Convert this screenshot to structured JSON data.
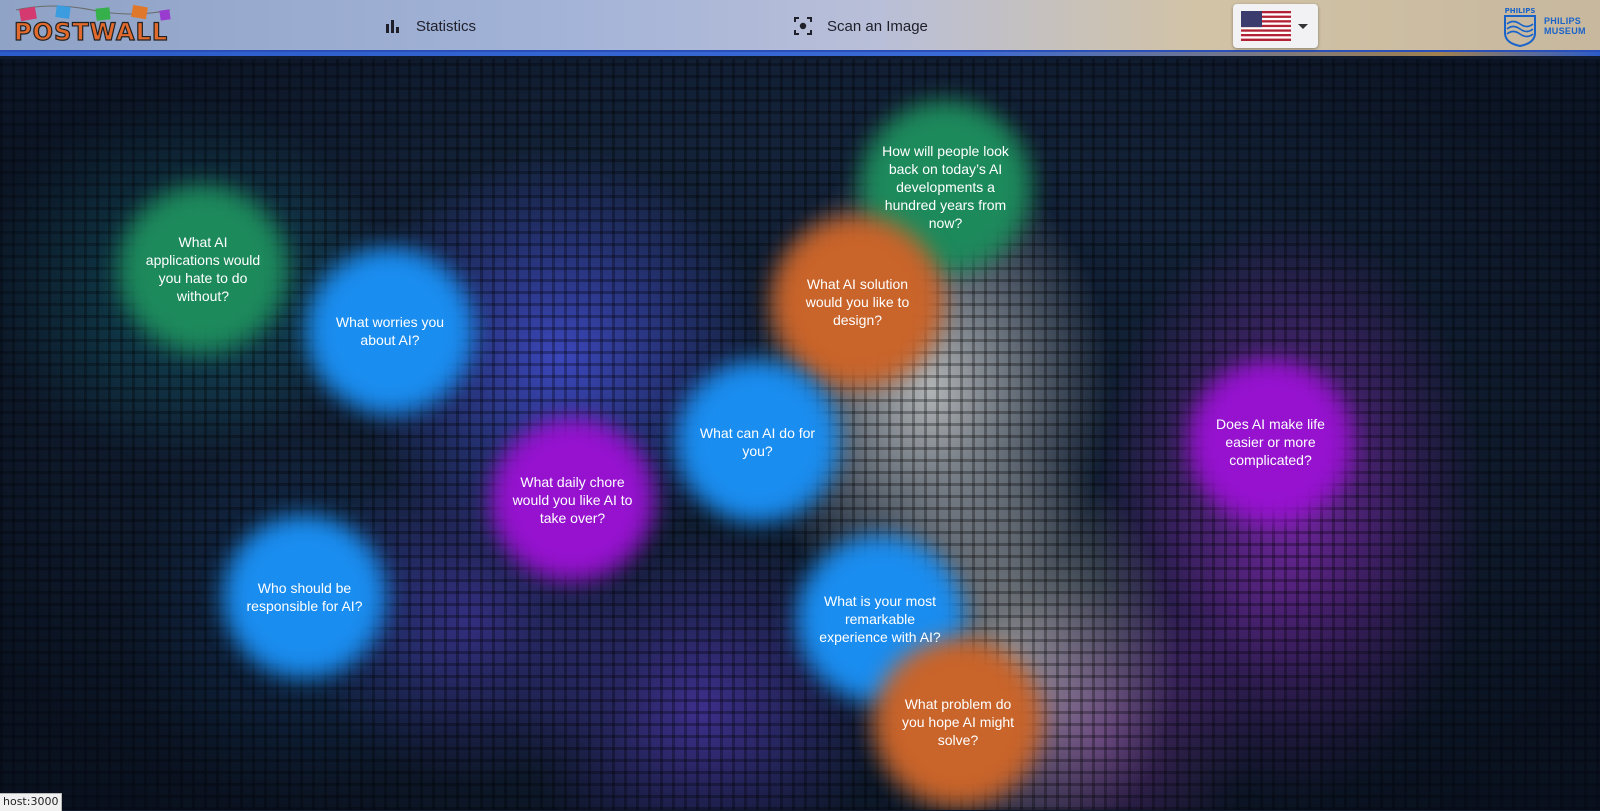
{
  "header": {
    "logo_text": "POSTWALL",
    "nav": {
      "statistics_label": "Statistics",
      "scan_label": "Scan an Image"
    },
    "language": {
      "selected": "English (US)",
      "flag_icon": "us-flag-icon"
    },
    "partner_logo": {
      "line1": "PHILIPS",
      "line2": "MUSEUM",
      "shield_text": "PHILIPS"
    }
  },
  "questions": [
    {
      "text": "What AI applications would you hate to do without?",
      "color": "green"
    },
    {
      "text": "What worries you about AI?",
      "color": "blue"
    },
    {
      "text": "How will people look back on today’s AI developments a hundred years from now?",
      "color": "green"
    },
    {
      "text": "What AI solution would you like to design?",
      "color": "orange"
    },
    {
      "text": "What can AI do for you?",
      "color": "blue"
    },
    {
      "text": "Does AI make life easier or more complicated?",
      "color": "purple"
    },
    {
      "text": "What daily chore would you like AI to take over?",
      "color": "purple"
    },
    {
      "text": "Who should be responsible for AI?",
      "color": "blue"
    },
    {
      "text": "What is your most remarkable experience with AI?",
      "color": "blue"
    },
    {
      "text": "What problem do you hope AI might solve?",
      "color": "orange"
    }
  ],
  "colors": {
    "green": "#1d8a5c",
    "blue": "#1a8df0",
    "orange": "#c9642a",
    "purple": "#9612cf",
    "header_accent": "#2a4fb8"
  },
  "status_bar": {
    "text": "host:3000"
  }
}
